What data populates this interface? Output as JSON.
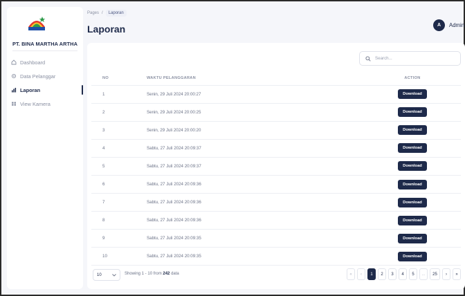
{
  "sidebar": {
    "brand": "PT. BINA MARTHA ARTHA",
    "items": [
      {
        "label": "Dashboard",
        "icon": "home-icon",
        "active": false
      },
      {
        "label": "Data Pelanggar",
        "icon": "user-gear-icon",
        "active": false
      },
      {
        "label": "Laporan",
        "icon": "bar-chart-icon",
        "active": true
      },
      {
        "label": "View Kamera",
        "icon": "camera-grid-icon",
        "active": false
      }
    ]
  },
  "header": {
    "breadcrumb_root": "Pages",
    "breadcrumb_sep": "/",
    "breadcrumb_current": "Laporan",
    "title": "Laporan",
    "user_initial": "A",
    "user_name": "Admin"
  },
  "search": {
    "placeholder": "Search..."
  },
  "table": {
    "headers": {
      "no": "NO",
      "time": "WAKTU PELANGGARAN",
      "action": "ACTION"
    },
    "action_label": "Download",
    "rows": [
      {
        "no": "1",
        "time": "Senin, 29 Juli 2024 20:00:27"
      },
      {
        "no": "2",
        "time": "Senin, 29 Juli 2024 20:00:25"
      },
      {
        "no": "3",
        "time": "Senin, 29 Juli 2024 20:00:20"
      },
      {
        "no": "4",
        "time": "Sabtu, 27 Juli 2024 20:09:37"
      },
      {
        "no": "5",
        "time": "Sabtu, 27 Juli 2024 20:09:37"
      },
      {
        "no": "6",
        "time": "Sabtu, 27 Juli 2024 20:09:36"
      },
      {
        "no": "7",
        "time": "Sabtu, 27 Juli 2024 20:09:36"
      },
      {
        "no": "8",
        "time": "Sabtu, 27 Juli 2024 20:09:36"
      },
      {
        "no": "9",
        "time": "Sabtu, 27 Juli 2024 20:09:35"
      },
      {
        "no": "10",
        "time": "Sabtu, 27 Juli 2024 20:09:35"
      }
    ]
  },
  "footer": {
    "page_size": "10",
    "showing_prefix": "Showing 1 - 10 from",
    "total": "242",
    "showing_suffix": "data",
    "pages": [
      "«",
      "‹",
      "1",
      "2",
      "3",
      "4",
      "5",
      "...",
      "25",
      "›",
      "»"
    ],
    "current_page": "1"
  },
  "colors": {
    "primary": "#1e2a4a",
    "muted_text": "#8a90a2",
    "background": "#f5f6fa"
  }
}
